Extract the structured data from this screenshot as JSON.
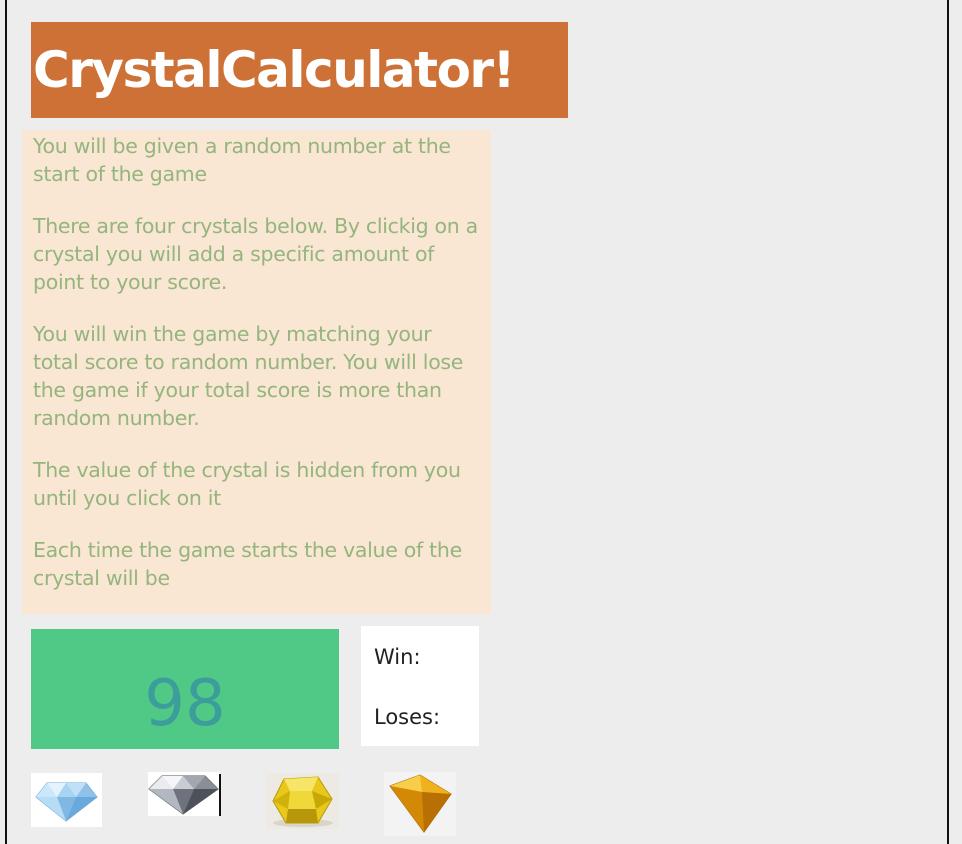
{
  "header": {
    "title": "CrystalCalculator!"
  },
  "instructions": {
    "paragraphs": [
      "You will be given a random number at the start of the game",
      "There are four crystals below. By clickig on a crystal you will add a specific amount of point to your score.",
      "You will win the game by matching your total score to random number. You will lose the game if your total score is more than random number.",
      "The value of the crystal is hidden from you until you click on it",
      "Each time the game starts the value of the crystal will be"
    ]
  },
  "game": {
    "target_number": "98",
    "win_label": "Win:",
    "loses_label": "Loses:"
  },
  "crystals": [
    {
      "icon": "blue-diamond-icon"
    },
    {
      "icon": "clear-diamond-icon"
    },
    {
      "icon": "yellow-gem-icon"
    },
    {
      "icon": "orange-gem-icon"
    }
  ],
  "colors": {
    "title_bg": "#cd7136",
    "instructions_bg": "#f9e6d3",
    "instructions_text": "#94b57e",
    "target_bg": "#51c986",
    "target_text": "#3c9e9b"
  }
}
